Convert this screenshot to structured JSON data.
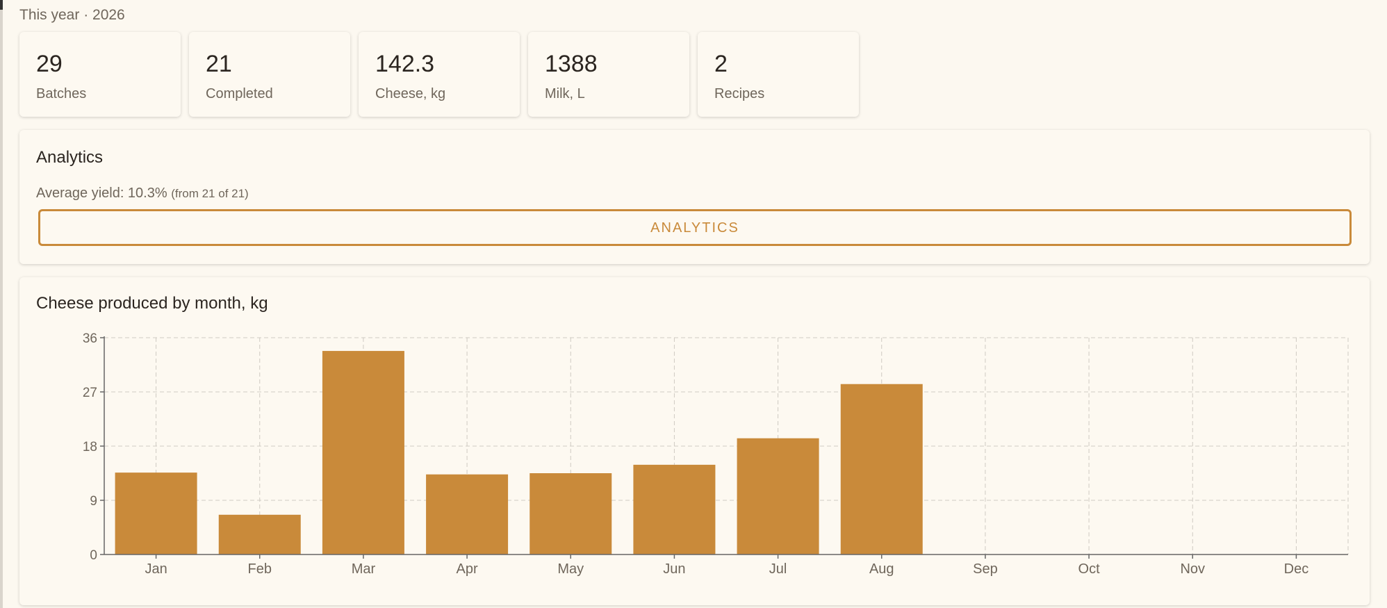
{
  "period_label": "This year · 2026",
  "stats": [
    {
      "value": "29",
      "label": "Batches"
    },
    {
      "value": "21",
      "label": "Completed"
    },
    {
      "value": "142.3",
      "label": "Cheese, kg"
    },
    {
      "value": "1388",
      "label": "Milk, L"
    },
    {
      "value": "2",
      "label": "Recipes"
    }
  ],
  "analytics": {
    "title": "Analytics",
    "average_yield": "Average yield: 10.3%",
    "average_yield_note": "(from 21 of 21)",
    "button_label": "ANALYTICS"
  },
  "chart_panel": {
    "title": "Cheese produced by month, kg"
  },
  "colors": {
    "accent": "#c98a3a",
    "background": "#fcf8f0",
    "card": "#fdf9f1"
  },
  "chart_data": {
    "type": "bar",
    "title": "Cheese produced by month, kg",
    "xlabel": "",
    "ylabel": "",
    "categories": [
      "Jan",
      "Feb",
      "Mar",
      "Apr",
      "May",
      "Jun",
      "Jul",
      "Aug",
      "Sep",
      "Oct",
      "Nov",
      "Dec"
    ],
    "values": [
      13.6,
      6.6,
      33.8,
      13.3,
      13.5,
      14.9,
      19.3,
      28.3,
      0,
      0,
      0,
      0
    ],
    "ylim": [
      0,
      36
    ],
    "yticks": [
      "0",
      "9",
      "18",
      "27",
      "36"
    ],
    "grid": true,
    "bar_color": "#c98a3a"
  }
}
